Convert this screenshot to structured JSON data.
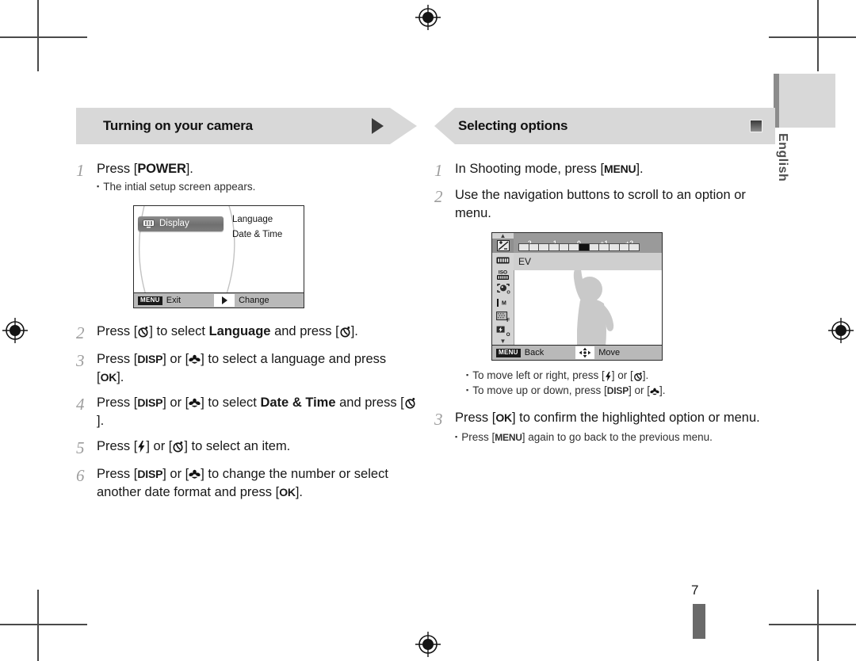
{
  "document": {
    "language_tab": "English",
    "page_number": "7"
  },
  "left_column": {
    "banner": {
      "title": "Turning on your camera",
      "marker_icon": "play-triangle-icon"
    },
    "steps": [
      {
        "num": "1",
        "prefix": "Press [",
        "key": "POWER",
        "suffix": "].",
        "notes": [
          "The intial setup screen appears."
        ]
      },
      {
        "num": "2",
        "segments": [
          {
            "t": "text",
            "v": "Press ["
          },
          {
            "t": "icon",
            "v": "self-timer-icon"
          },
          {
            "t": "text",
            "v": "] to select "
          },
          {
            "t": "bold",
            "v": "Language"
          },
          {
            "t": "text",
            "v": " and press ["
          },
          {
            "t": "icon",
            "v": "self-timer-icon"
          },
          {
            "t": "text",
            "v": "]."
          }
        ]
      },
      {
        "num": "3",
        "segments": [
          {
            "t": "text",
            "v": "Press ["
          },
          {
            "t": "key",
            "v": "DISP"
          },
          {
            "t": "text",
            "v": "] or ["
          },
          {
            "t": "icon",
            "v": "macro-flower-icon"
          },
          {
            "t": "text",
            "v": "] to select a language and press ["
          },
          {
            "t": "key",
            "v": "OK"
          },
          {
            "t": "text",
            "v": "]."
          }
        ]
      },
      {
        "num": "4",
        "segments": [
          {
            "t": "text",
            "v": "Press ["
          },
          {
            "t": "key",
            "v": "DISP"
          },
          {
            "t": "text",
            "v": "] or ["
          },
          {
            "t": "icon",
            "v": "macro-flower-icon"
          },
          {
            "t": "text",
            "v": "] to select "
          },
          {
            "t": "bold",
            "v": "Date & Time"
          },
          {
            "t": "text",
            "v": " and press ["
          },
          {
            "t": "icon",
            "v": "self-timer-icon"
          },
          {
            "t": "text",
            "v": "]."
          }
        ]
      },
      {
        "num": "5",
        "segments": [
          {
            "t": "text",
            "v": "Press ["
          },
          {
            "t": "icon",
            "v": "flash-bolt-icon"
          },
          {
            "t": "text",
            "v": "] or ["
          },
          {
            "t": "icon",
            "v": "self-timer-icon"
          },
          {
            "t": "text",
            "v": "] to select an item."
          }
        ]
      },
      {
        "num": "6",
        "segments": [
          {
            "t": "text",
            "v": "Press ["
          },
          {
            "t": "key",
            "v": "DISP"
          },
          {
            "t": "text",
            "v": "] or ["
          },
          {
            "t": "icon",
            "v": "macro-flower-icon"
          },
          {
            "t": "text",
            "v": "] to change the number or select another date format and press ["
          },
          {
            "t": "key",
            "v": "OK"
          },
          {
            "t": "text",
            "v": "]."
          }
        ]
      }
    ],
    "screen": {
      "selected_tab": "Display",
      "tab_icon": "monitor-icon",
      "menu_items": [
        "Language",
        "Date & Time"
      ],
      "bottom_bar": {
        "menu_badge": "MENU",
        "left_label": "Exit",
        "right_icon": "play-triangle-icon",
        "right_label": "Change"
      }
    }
  },
  "right_column": {
    "banner": {
      "title": "Selecting options",
      "marker_icon": "square-marker-icon"
    },
    "steps": [
      {
        "num": "1",
        "segments": [
          {
            "t": "text",
            "v": "In Shooting mode, press ["
          },
          {
            "t": "key",
            "v": "MENU"
          },
          {
            "t": "text",
            "v": "]."
          }
        ]
      },
      {
        "num": "2",
        "segments": [
          {
            "t": "text",
            "v": "Use the navigation buttons to scroll to an option or menu."
          }
        ]
      },
      {
        "num": "3",
        "segments": [
          {
            "t": "text",
            "v": "Press ["
          },
          {
            "t": "key",
            "v": "OK"
          },
          {
            "t": "text",
            "v": "] to confirm the highlighted option or menu."
          }
        ]
      }
    ],
    "screen_notes": [
      [
        {
          "t": "text",
          "v": "To move left or right, press ["
        },
        {
          "t": "icon",
          "v": "flash-bolt-icon"
        },
        {
          "t": "text",
          "v": "] or ["
        },
        {
          "t": "icon",
          "v": "self-timer-icon"
        },
        {
          "t": "text",
          "v": "]."
        }
      ],
      [
        {
          "t": "text",
          "v": "To move up or down, press ["
        },
        {
          "t": "key",
          "v": "DISP"
        },
        {
          "t": "text",
          "v": "] or ["
        },
        {
          "t": "icon",
          "v": "macro-flower-icon"
        },
        {
          "t": "text",
          "v": "]."
        }
      ]
    ],
    "step3_notes": [
      [
        {
          "t": "text",
          "v": "Press ["
        },
        {
          "t": "key",
          "v": "MENU"
        },
        {
          "t": "text",
          "v": "] again to go back to the previous menu."
        }
      ]
    ],
    "screen": {
      "option_label": "EV",
      "ev_scale": {
        "labels": [
          "-2",
          "-1",
          "0",
          "+1",
          "+2"
        ],
        "tick_count": 13,
        "selected_tick_index": 6
      },
      "sidebar_icons": [
        "ev-exposure-icon",
        "white-balance-icon",
        "iso-icon",
        "face-detection-off-icon",
        "focus-area-icon",
        "image-quality-f-icon",
        "flash-off-icon"
      ],
      "bottom_bar": {
        "menu_badge": "MENU",
        "left_label": "Back",
        "right_icon": "dpad-move-icon",
        "right_label": "Move"
      }
    }
  }
}
